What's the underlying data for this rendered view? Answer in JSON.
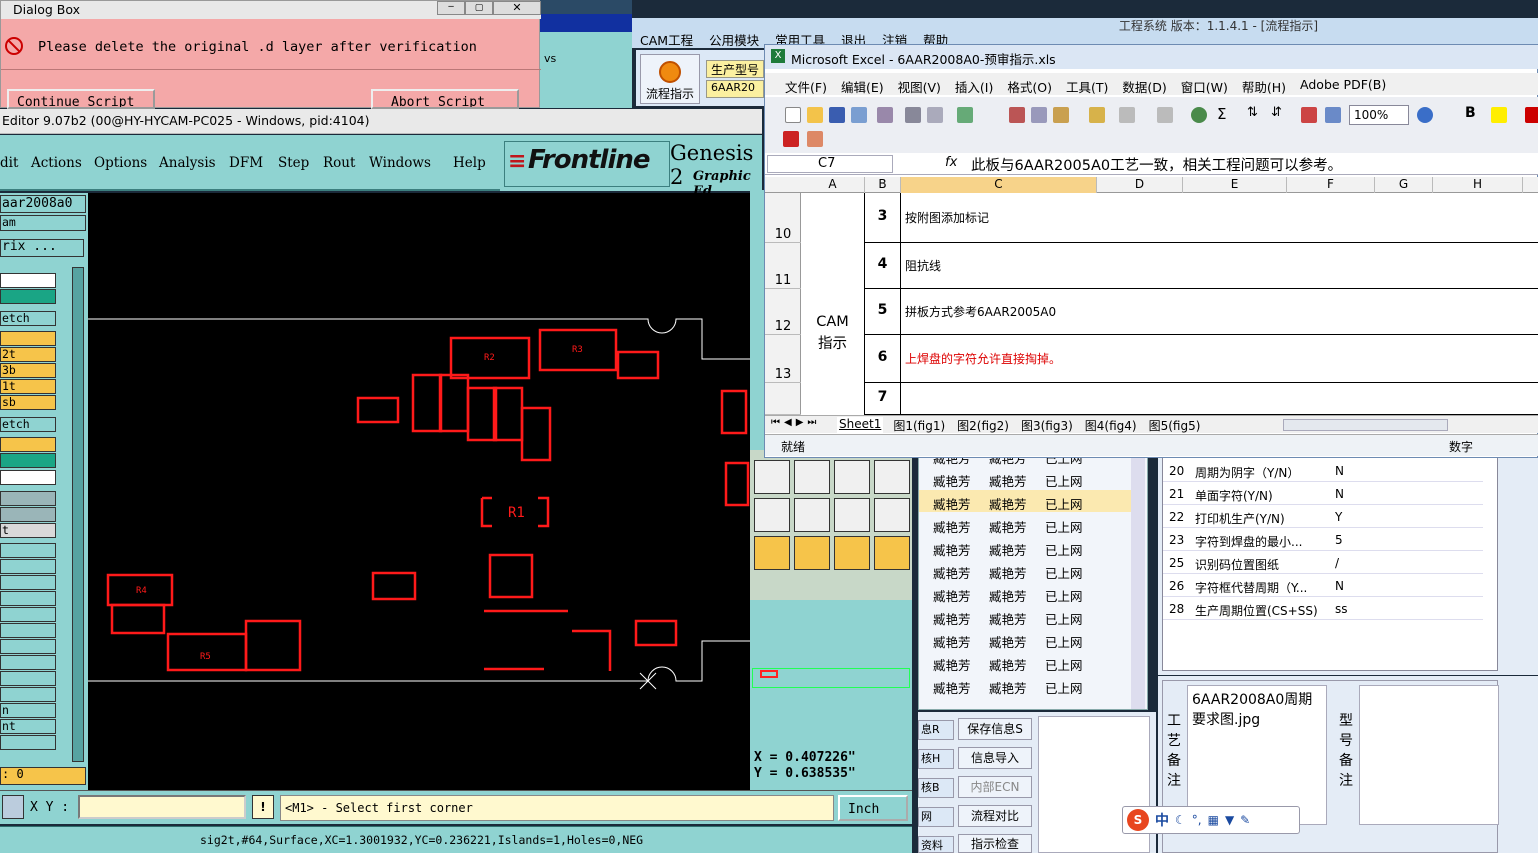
{
  "dialog": {
    "title": "Dialog Box",
    "message": "Please delete the original .d layer after verification",
    "continue_label": "Continue Script",
    "abort_label": "Abort Script"
  },
  "genesis": {
    "title": "Editor 9.07b2 (00@HY-HYCAM-PC025 - Windows, pid:4104)",
    "menu": [
      "dit",
      "Actions",
      "Options",
      "Analysis",
      "DFM",
      "Step",
      "Rout",
      "Windows",
      "Help"
    ],
    "logo": "Frontline",
    "product": "Genesis 2",
    "subtitle": "Graphic Ed",
    "job_name": "aar2008a0",
    "panel_labels": [
      "am",
      "rix ...",
      "etch",
      "2t",
      "3b",
      "1t",
      "sb",
      "etch",
      "t",
      "n",
      "nt",
      ": 0"
    ],
    "coords": {
      "x": "X = 0.407226\"",
      "y": "Y = 0.638535\""
    },
    "xy_label": "X Y :",
    "prompt": "<M1> - Select first corner",
    "units": "Inch",
    "status": "sig2t,#64,Surface,XC=1.3001932,YC=0.236221,Islands=1,Holes=0,NEG",
    "pad_labels": [
      "R2",
      "R3",
      "R1",
      "R5",
      "R4"
    ]
  },
  "cam_app": {
    "menu": [
      "CAM工程",
      "公用模块",
      "常用工具",
      "退出",
      "注销",
      "帮助"
    ],
    "title": "工程系统  版本：1.1.4.1 - [流程指示]",
    "flow_button": "流程指示",
    "model_label": "生产型号",
    "model_value": "6AAR20",
    "list_rows": [
      [
        "臧艳芳",
        "臧艳芳",
        "已上网"
      ],
      [
        "臧艳芳",
        "臧艳芳",
        "已上网"
      ],
      [
        "臧艳芳",
        "臧艳芳",
        "已上网"
      ],
      [
        "臧艳芳",
        "臧艳芳",
        "已上网"
      ],
      [
        "臧艳芳",
        "臧艳芳",
        "已上网"
      ],
      [
        "臧艳芳",
        "臧艳芳",
        "已上网"
      ],
      [
        "臧艳芳",
        "臧艳芳",
        "已上网"
      ],
      [
        "臧艳芳",
        "臧艳芳",
        "已上网"
      ],
      [
        "臧艳芳",
        "臧艳芳",
        "已上网"
      ],
      [
        "臧艳芳",
        "臧艳芳",
        "已上网"
      ],
      [
        "臧艳芳",
        "臧艳芳",
        "已上网"
      ]
    ],
    "buttons_left": [
      "息R",
      "核H",
      "核B",
      "网",
      "资料"
    ],
    "buttons_right": [
      "保存信息S",
      "信息导入",
      "内部ECN",
      "流程对比",
      "指示检查"
    ],
    "params": [
      [
        "20",
        "周期为阴字（Y/N）",
        "N"
      ],
      [
        "21",
        "单面字符(Y/N)",
        "N"
      ],
      [
        "22",
        "打印机生产(Y/N)",
        "Y"
      ],
      [
        "23",
        "字符到焊盘的最小...",
        "5"
      ],
      [
        "25",
        "识别码位置图纸",
        "/"
      ],
      [
        "26",
        "字符框代替周期（Y...",
        "N"
      ],
      [
        "28",
        "生产周期位置(CS+SS)",
        "ss"
      ]
    ],
    "note_label": "工艺备注",
    "note_text": "6AAR2008A0周期要求图.jpg",
    "model_note_label": "型号备注",
    "ime_label": "中"
  },
  "excel": {
    "title": "Microsoft Excel - 6AAR2008A0-预审指示.xls",
    "menu": [
      "文件(F)",
      "编辑(E)",
      "视图(V)",
      "插入(I)",
      "格式(O)",
      "工具(T)",
      "数据(D)",
      "窗口(W)",
      "帮助(H)",
      "Adobe PDF(B)"
    ],
    "zoom": "100%",
    "cell_ref": "C7",
    "formula": "此板与6AAR2005A0工艺一致，相关工程问题可以参考。",
    "columns": [
      "A",
      "B",
      "C",
      "D",
      "E",
      "F",
      "G",
      "H"
    ],
    "rows": [
      {
        "num": "10",
        "b": "3",
        "c": "按附图添加标记",
        "red": false
      },
      {
        "num": "11",
        "b": "4",
        "c": "阻抗线",
        "red": false
      },
      {
        "num": "12",
        "b": "5",
        "c": "拼板方式参考6AAR2005A0",
        "red": false
      },
      {
        "num": "13",
        "b": "6",
        "c": "上焊盘的字符允许直接掏掉。",
        "red": true
      },
      {
        "num": "",
        "b": "7",
        "c": "",
        "red": false
      }
    ],
    "merged_a": "CAM指示",
    "sheets": [
      "Sheet1",
      "图1(fig1)",
      "图2(fig2)",
      "图3(fig3)",
      "图4(fig4)",
      "图5(fig5)"
    ],
    "status_left": "就绪",
    "status_right": "数字"
  },
  "colors": {
    "genesis_teal": "#8fd3d1",
    "pcb_red": "#ff1a1a",
    "dialog_pink": "#f4a8a8",
    "excel_blue": "#dbe6f4"
  }
}
